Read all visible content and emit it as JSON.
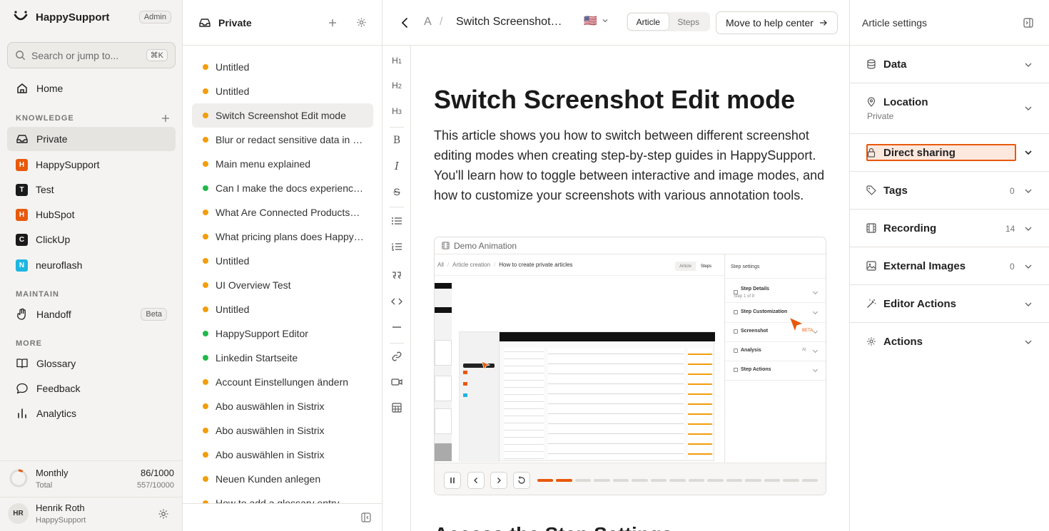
{
  "sidebar": {
    "brand": "HappySupport",
    "role_badge": "Admin",
    "search_placeholder": "Search or jump to...",
    "search_shortcut": "⌘K",
    "home": "Home",
    "knowledge_title": "KNOWLEDGE",
    "spaces": [
      {
        "label": "Private",
        "letter": "",
        "color": ""
      },
      {
        "label": "HappySupport",
        "letter": "H",
        "color": "#e8590c"
      },
      {
        "label": "Test",
        "letter": "T",
        "color": "#1a1a1a"
      },
      {
        "label": "HubSpot",
        "letter": "H",
        "color": "#e8590c"
      },
      {
        "label": "ClickUp",
        "letter": "C",
        "color": "#1a1a1a"
      },
      {
        "label": "neuroflash",
        "letter": "N",
        "color": "#1fb5e0"
      }
    ],
    "maintain_title": "MAINTAIN",
    "handoff": "Handoff",
    "handoff_badge": "Beta",
    "more_title": "MORE",
    "more_items": [
      "Glossary",
      "Feedback",
      "Analytics"
    ],
    "usage": {
      "period": "Monthly",
      "period_value": "86/1000",
      "total": "Total",
      "total_value": "557/10000",
      "progress": 0.086
    },
    "user": {
      "initials": "HR",
      "name": "Henrik Roth",
      "org": "HappySupport"
    }
  },
  "article_list": {
    "title": "Private",
    "items": [
      {
        "label": "Untitled",
        "status": "draft"
      },
      {
        "label": "Untitled",
        "status": "draft"
      },
      {
        "label": "Switch Screenshot Edit mode",
        "status": "draft"
      },
      {
        "label": "Blur or redact sensitive data in …",
        "status": "draft"
      },
      {
        "label": "Main menu explained",
        "status": "draft"
      },
      {
        "label": "Can I make the docs experienc…",
        "status": "published"
      },
      {
        "label": "What Are Connected Products…",
        "status": "draft"
      },
      {
        "label": "What pricing plans does Happy…",
        "status": "draft"
      },
      {
        "label": "Untitled",
        "status": "draft"
      },
      {
        "label": "UI Overview Test",
        "status": "draft"
      },
      {
        "label": "Untitled",
        "status": "draft"
      },
      {
        "label": "HappySupport Editor",
        "status": "published"
      },
      {
        "label": "Linkedin Startseite",
        "status": "published"
      },
      {
        "label": "Account Einstellungen ändern",
        "status": "draft"
      },
      {
        "label": "Abo auswählen in Sistrix",
        "status": "draft"
      },
      {
        "label": "Abo auswählen in Sistrix",
        "status": "draft"
      },
      {
        "label": "Abo auswählen in Sistrix",
        "status": "draft"
      },
      {
        "label": "Neuen Kunden anlegen",
        "status": "draft"
      },
      {
        "label": "How to add a glossary entry",
        "status": "draft"
      }
    ]
  },
  "colors": {
    "draft": "#f29d0b",
    "published": "#22b84a",
    "accent": "#e8590c",
    "highlight_bg": "#fde8de"
  },
  "topbar": {
    "breadcrumb_root": "A",
    "breadcrumb_sep": "/",
    "article_title": "Switch Screenshot…",
    "language_flag": "🇺🇸",
    "tab_article": "Article",
    "tab_steps": "Steps",
    "move_button": "Move to help center"
  },
  "editor_tools": [
    "H1",
    "H2",
    "H3",
    "B",
    "I",
    "S",
    "bullet-list",
    "ordered-list",
    "quote",
    "code",
    "divider",
    "link",
    "video",
    "table"
  ],
  "article": {
    "title": "Switch Screenshot Edit mode",
    "intro": "This article shows you how to switch between different screenshot editing modes when creating step-by-step guides in HappySupport. You'll learn how to toggle between interactive and image modes, and how to customize your screenshots with various annotation tools.",
    "next_heading": "Access the Step Settings",
    "demo": {
      "label": "Demo Animation",
      "crumb_all": "All",
      "crumb_section": "Article creation",
      "crumb_page": "How to create private articles",
      "tab_article": "Article",
      "tab_steps": "Steps",
      "panel_title": "Step settings",
      "panel_rows": [
        {
          "label": "Step Details",
          "sub": "Step 1 of 9",
          "value": ""
        },
        {
          "label": "Step Customization",
          "sub": "",
          "value": ""
        },
        {
          "label": "Screenshot",
          "sub": "",
          "value": "BETA"
        },
        {
          "label": "Analysis",
          "sub": "",
          "value": "AI"
        },
        {
          "label": "Step Actions",
          "sub": "",
          "value": ""
        }
      ],
      "progress_segments": 15,
      "progress_done": 2
    }
  },
  "settings": {
    "title": "Article settings",
    "rows": [
      {
        "label": "Data",
        "sub": "",
        "count": "",
        "icon": "database-icon"
      },
      {
        "label": "Location",
        "sub": "Private",
        "count": "",
        "icon": "location-pin-icon"
      },
      {
        "label": "Direct sharing",
        "sub": "",
        "count": "",
        "icon": "lock-icon"
      },
      {
        "label": "Tags",
        "sub": "",
        "count": "0",
        "icon": "tag-icon"
      },
      {
        "label": "Recording",
        "sub": "",
        "count": "14",
        "icon": "film-icon"
      },
      {
        "label": "External Images",
        "sub": "",
        "count": "0",
        "icon": "image-icon"
      },
      {
        "label": "Editor Actions",
        "sub": "",
        "count": "",
        "icon": "wand-icon"
      },
      {
        "label": "Actions",
        "sub": "",
        "count": "",
        "icon": "gear-icon"
      }
    ]
  }
}
